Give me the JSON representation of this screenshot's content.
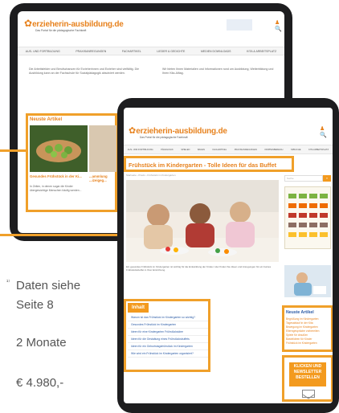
{
  "back_site": {
    "logo_prefix": "erzieherin-",
    "logo_suffix": "ausbildung.de",
    "tagline": "Das Portal für die pädagogische Fachkraft",
    "nav": [
      "AUS- UND FORTBILDUNG",
      "PRAXISANREGUNGEN",
      "FACHARTIKEL",
      "LIEDER & GEDICHTE",
      "MEDIEN DOWNLOADS",
      "KITA & ARBEITSPLATZ"
    ],
    "intro_left": "Die Arbeitsfelder und Berufschancen für Erzieherinnen und Erzieher sind vielfältig. Die Ausbildung kann an der Fachschule für Sozialpädagogik absolviert werden.",
    "intro_right": "Wir bieten Ihnen Materialien und Informationen rund um Ausbildung, Weiterbildung und Ihren Kita-Alltag.",
    "news_heading": "Neuste Artikel",
    "news_title": "Gesundes Frühstück in der Ki...",
    "news_text": "In Zeiten, in denen sogar die Kinder übergewichtige Menschen häufig werden...",
    "news_title_2": "...ammlung ...izeigeg..."
  },
  "front_site": {
    "logo_prefix": "erzieherin-",
    "logo_suffix": "ausbildung.de",
    "tagline": "Das Portal für die pädagogische Fachkraft",
    "nav": [
      "AUS- UND FORTBILDUNG",
      "PÄDAGOGIK",
      "SPIELEN",
      "BAUEN",
      "FACHARTIKEL",
      "PRAXISANREGUNGEN",
      "KRIPPENBEREICH",
      "SPRACHE",
      "KITA ARBEITSPLATZ"
    ],
    "article_title": "Frühstück im Kindergarten - Tolle Ideen für das Buffet",
    "breadcrumb": "Startseite › Praxis › Frühstück im Kindergarten",
    "body_text": "Ein gesundes Frühstück im Kindergarten ist wichtig für die Entwicklung der Kinder. Hier finden Sie Ideen und Anregungen für ein buntes Frühstücksbuffet in Ihrer Einrichtung.",
    "toc_heading": "Inhalt",
    "toc": [
      "Warum ist das Frühstück im Kindergarten so wichtig?",
      "Gesundes Frühstück im Kindergarten",
      "Ideen für eine Kindergarten Frühstücksidee",
      "Ideen für die Gestaltung eines Frühstücksbuffets",
      "Ideen für ein Geburtstagsfrühstück im Kindergarten",
      "Wie wird ein Frühstück im Kindergarten organisiert?"
    ],
    "search_placeholder": "Suche",
    "search_button": "»",
    "sidebar_news_heading": "Neuste Artikel",
    "sidebar_links": [
      "Begrüßung im Kindergarten",
      "Tagesablauf in der Kita",
      "Bewegung im Kindergarten",
      "Elterngespräche vorbereiten",
      "Spiele für draußen",
      "Bastelideen für Kinder",
      "Frühstück im Kindergarten"
    ],
    "newsletter_cta": "KLICKEN UND NEWSLETTER BESTELLEN"
  },
  "info": {
    "footnote": "¹⁾",
    "data_line1": "Daten siehe",
    "data_line2": "Seite 8",
    "duration": "2 Monate",
    "price": "€ 4.980,-"
  },
  "colors": {
    "accent": "#f0a02a",
    "logo_orange": "#e7821e",
    "logo_blue": "#2d5ca6",
    "device": "#1d1d1f"
  }
}
